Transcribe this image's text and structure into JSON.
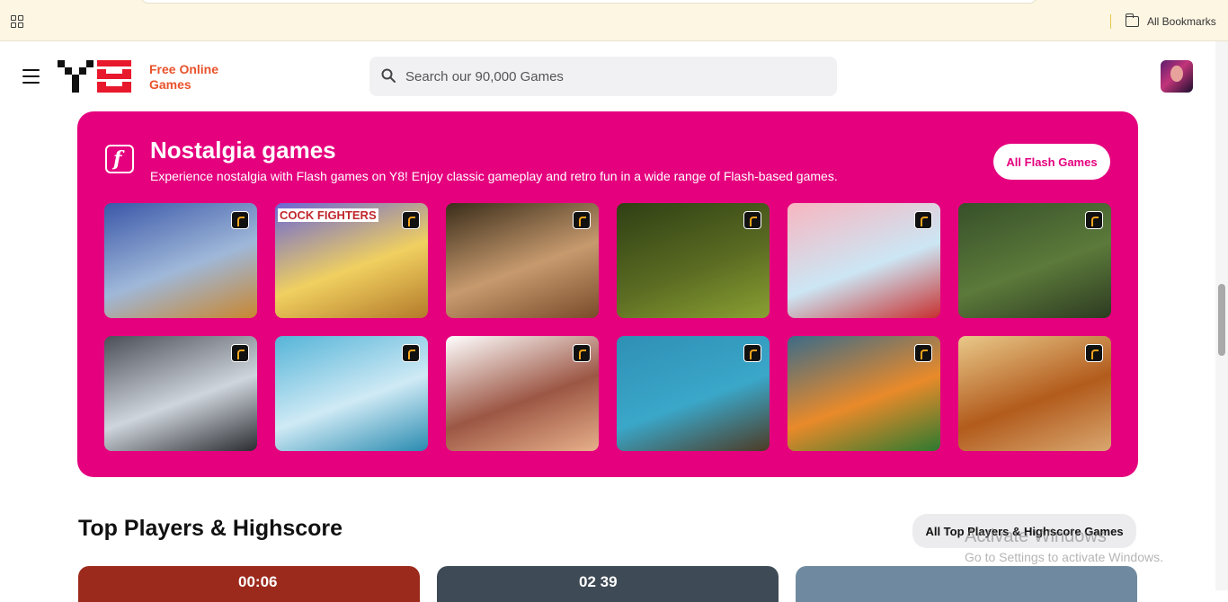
{
  "bookmarks_bar": {
    "all_bookmarks": "All Bookmarks"
  },
  "header": {
    "logo_text_line1": "Free Online",
    "logo_text_line2": "Games",
    "search_placeholder": "Search our 90,000 Games"
  },
  "nostalgia": {
    "title": "Nostalgia games",
    "description": "Experience nostalgia with Flash games on Y8! Enjoy classic gameplay and retro fun in a wide range of Flash-based games.",
    "all_button": "All Flash Games",
    "thumbnails": [
      {
        "caption": "",
        "colors": [
          "#3b57a8",
          "#9fb8d9",
          "#c9862f"
        ]
      },
      {
        "caption": "COCK FIGHTERS",
        "colors": [
          "#6a66d6",
          "#f0d060",
          "#b47a2a"
        ]
      },
      {
        "caption": "",
        "colors": [
          "#3a2d1a",
          "#c79a6e",
          "#7a4b2a"
        ]
      },
      {
        "caption": "",
        "colors": [
          "#2f3f14",
          "#5a6b22",
          "#89a032"
        ]
      },
      {
        "caption": "",
        "colors": [
          "#f7b6c0",
          "#cce6f4",
          "#c73030"
        ]
      },
      {
        "caption": "",
        "colors": [
          "#37502a",
          "#5c7a3a",
          "#2d3b22"
        ]
      },
      {
        "caption": "",
        "colors": [
          "#4b4f57",
          "#cfd5dd",
          "#2a2c30"
        ]
      },
      {
        "caption": "",
        "colors": [
          "#55b4d8",
          "#cfeaf5",
          "#2a8bb0"
        ]
      },
      {
        "caption": "",
        "colors": [
          "#ffffff",
          "#9c5644",
          "#e7b08a"
        ]
      },
      {
        "caption": "",
        "colors": [
          "#2f8fb5",
          "#3aa7c9",
          "#4d3a24"
        ]
      },
      {
        "caption": "",
        "colors": [
          "#3c6b88",
          "#e98a2a",
          "#2d7a30"
        ]
      },
      {
        "caption": "",
        "colors": [
          "#e9c98a",
          "#b25b1c",
          "#d9a770"
        ]
      }
    ]
  },
  "top_players": {
    "title": "Top Players & Highscore",
    "all_button": "All Top Players & Highscore Games",
    "cards": [
      {
        "text": "00:06",
        "color": "#9c2a1c"
      },
      {
        "text": "02 39",
        "color": "#3e4a55"
      },
      {
        "text": "",
        "color": "#6f8aa0"
      }
    ]
  },
  "watermark": {
    "line1": "Activate Windows",
    "line2": "Go to Settings to activate Windows."
  }
}
